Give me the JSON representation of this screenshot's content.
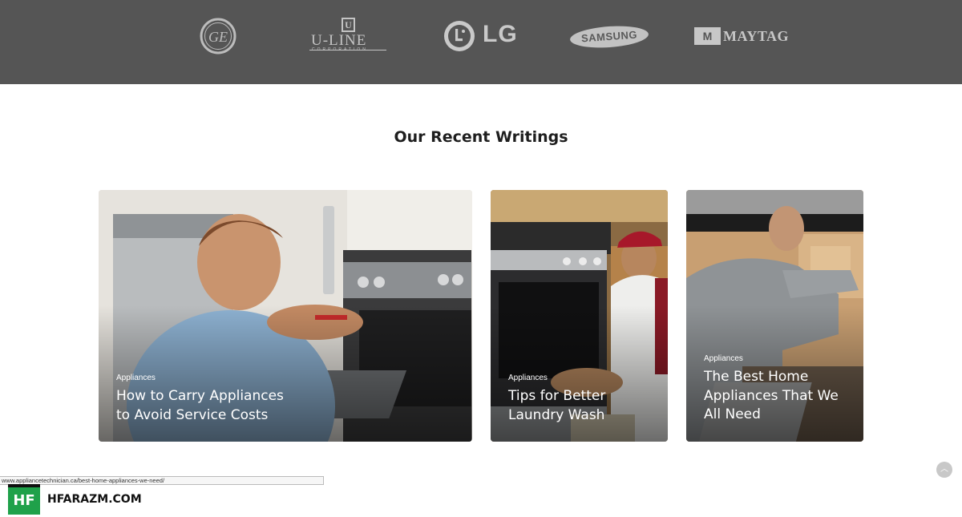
{
  "brands": {
    "ge": "GE",
    "uline": {
      "name": "U-LINE",
      "sub": "CORPORATION",
      "mark": "U"
    },
    "lg": "LG",
    "samsung": "SAMSUNG",
    "maytag": {
      "name": "MAYTAG",
      "mark": "M"
    }
  },
  "section": {
    "title": "Our Recent Writings"
  },
  "posts": [
    {
      "category": "Appliances",
      "title_line1": "How to Carry Appliances",
      "title_line2": "to Avoid Service Costs"
    },
    {
      "category": "Appliances",
      "title_line1": "Tips for Better",
      "title_line2": "Laundry Wash"
    },
    {
      "category": "Appliances",
      "title_line1": "The Best Home",
      "title_line2": "Appliances That We",
      "title_line3": "All Need"
    }
  ],
  "status_bar": {
    "url": "www.appliancetechnician.ca/best-home-appliances-we-need/"
  },
  "scroll_top": {
    "icon": "chevron-up-icon",
    "glyph": "︿"
  },
  "watermark": {
    "logo": "HF",
    "text": "HFARAZM.COM",
    "color": "#1fa14a"
  },
  "colors": {
    "brand_bar": "#555555",
    "accent_green": "#1fa14a"
  }
}
